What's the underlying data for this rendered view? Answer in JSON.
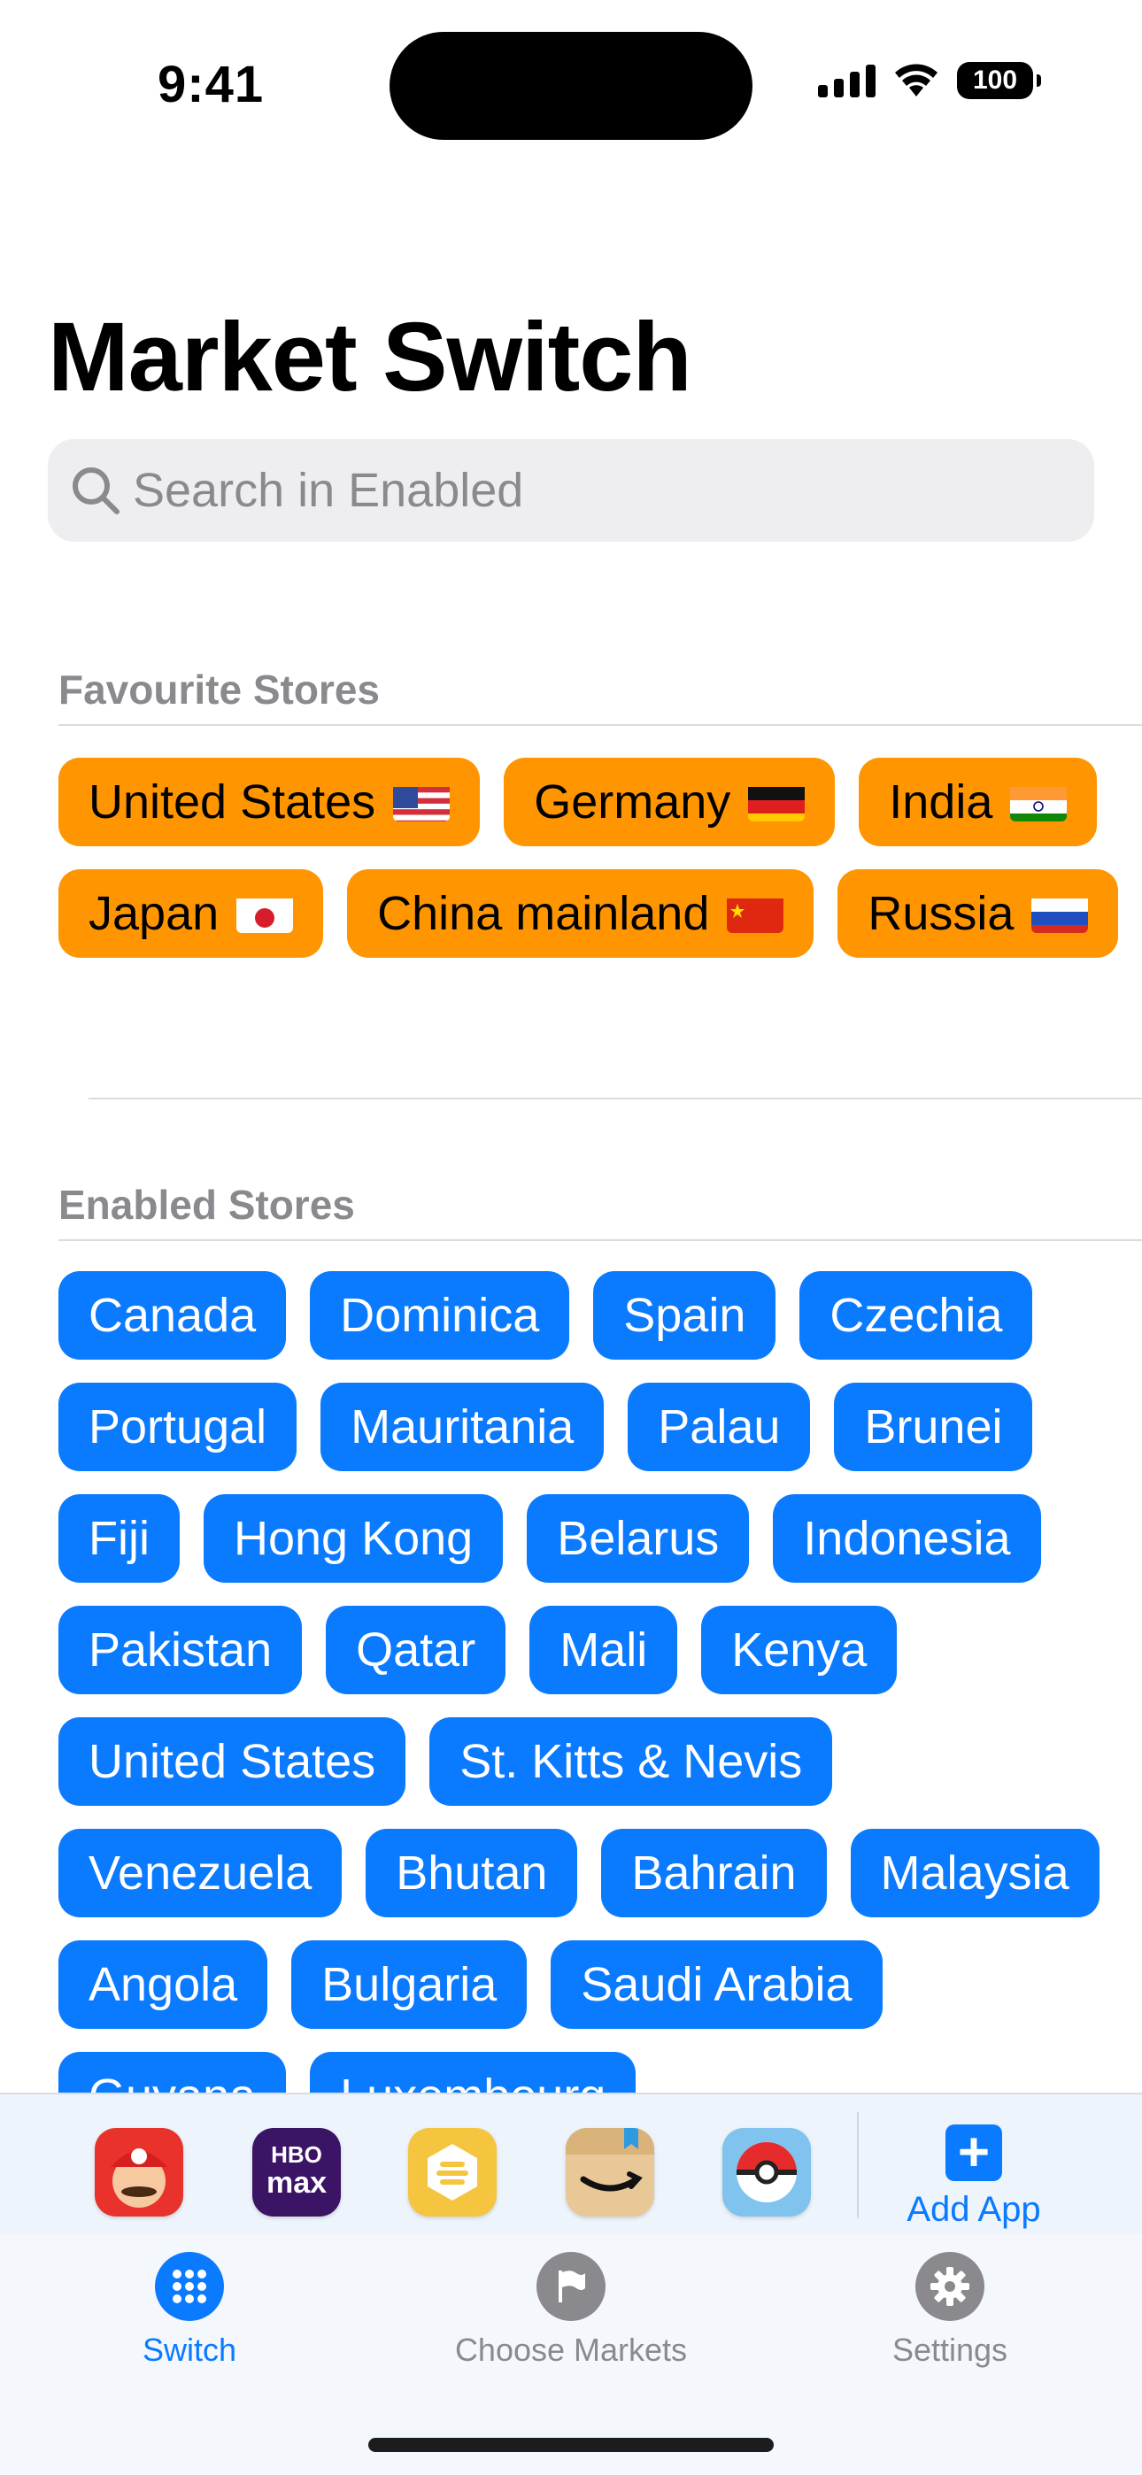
{
  "status_bar": {
    "time": "9:41",
    "battery": "100"
  },
  "page_title": "Market Switch",
  "search": {
    "placeholder": "Search in Enabled"
  },
  "favourites": {
    "header": "Favourite Stores",
    "items": [
      {
        "label": "United States",
        "flag": "us"
      },
      {
        "label": "Germany",
        "flag": "de"
      },
      {
        "label": "India",
        "flag": "in"
      },
      {
        "label": "Japan",
        "flag": "jp"
      },
      {
        "label": "China mainland",
        "flag": "cn"
      },
      {
        "label": "Russia",
        "flag": "ru"
      }
    ]
  },
  "enabled": {
    "header": "Enabled Stores",
    "items": [
      "Canada",
      "Dominica",
      "Spain",
      "Czechia",
      "Portugal",
      "Mauritania",
      "Palau",
      "Brunei",
      "Fiji",
      "Hong Kong",
      "Belarus",
      "Indonesia",
      "Pakistan",
      "Qatar",
      "Mali",
      "Kenya",
      "United States",
      "St. Kitts & Nevis",
      "Venezuela",
      "Bhutan",
      "Bahrain",
      "Malaysia",
      "Angola",
      "Bulgaria",
      "Saudi Arabia",
      "Guyana",
      "Luxembourg"
    ]
  },
  "app_bar": {
    "apps": [
      "super-mario-run-icon",
      "hbo-max-icon",
      "bumble-icon",
      "amazon-icon",
      "pokemon-go-icon"
    ],
    "add_label": "Add App",
    "hbo_text": [
      "HBO",
      "max"
    ]
  },
  "tabs": [
    {
      "label": "Switch",
      "icon": "grid-icon",
      "active": true
    },
    {
      "label": "Choose Markets",
      "icon": "flag-icon",
      "active": false
    },
    {
      "label": "Settings",
      "icon": "gear-icon",
      "active": false
    }
  ],
  "colors": {
    "accent": "#0a7aff",
    "favourite": "#ff9500",
    "muted": "#8a8a8e"
  }
}
